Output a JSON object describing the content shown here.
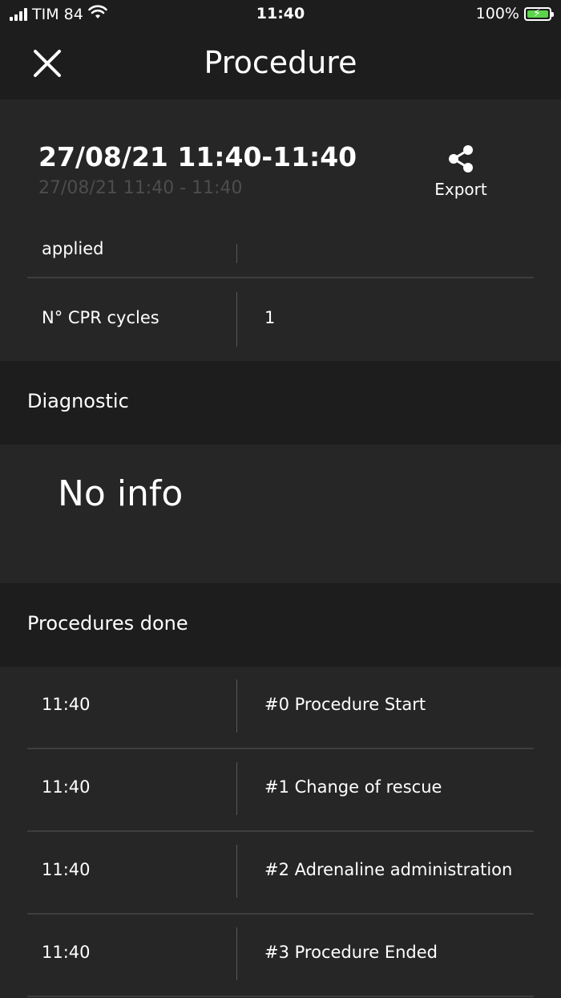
{
  "status_bar": {
    "carrier": "TIM 84",
    "time": "11:40",
    "battery": "100%",
    "battery_color": "#5bd44a"
  },
  "nav": {
    "title": "Procedure",
    "close_icon": "close-icon"
  },
  "summary": {
    "title": "27/08/21 11:40-11:40",
    "subtitle": "27/08/21 11:40 - 11:40",
    "export_label": "Export",
    "export_icon": "share-icon",
    "rows": [
      {
        "label": "applied",
        "value": ""
      },
      {
        "label": "N° CPR cycles",
        "value": "1"
      }
    ]
  },
  "diagnostic": {
    "header": "Diagnostic",
    "empty_text": "No info"
  },
  "procedures": {
    "header": "Procedures done",
    "items": [
      {
        "time": "11:40",
        "name": "#0 Procedure Start"
      },
      {
        "time": "11:40",
        "name": "#1 Change of rescue"
      },
      {
        "time": "11:40",
        "name": "#2 Adrenaline administration"
      },
      {
        "time": "11:40",
        "name": "#3 Procedure Ended"
      }
    ]
  }
}
